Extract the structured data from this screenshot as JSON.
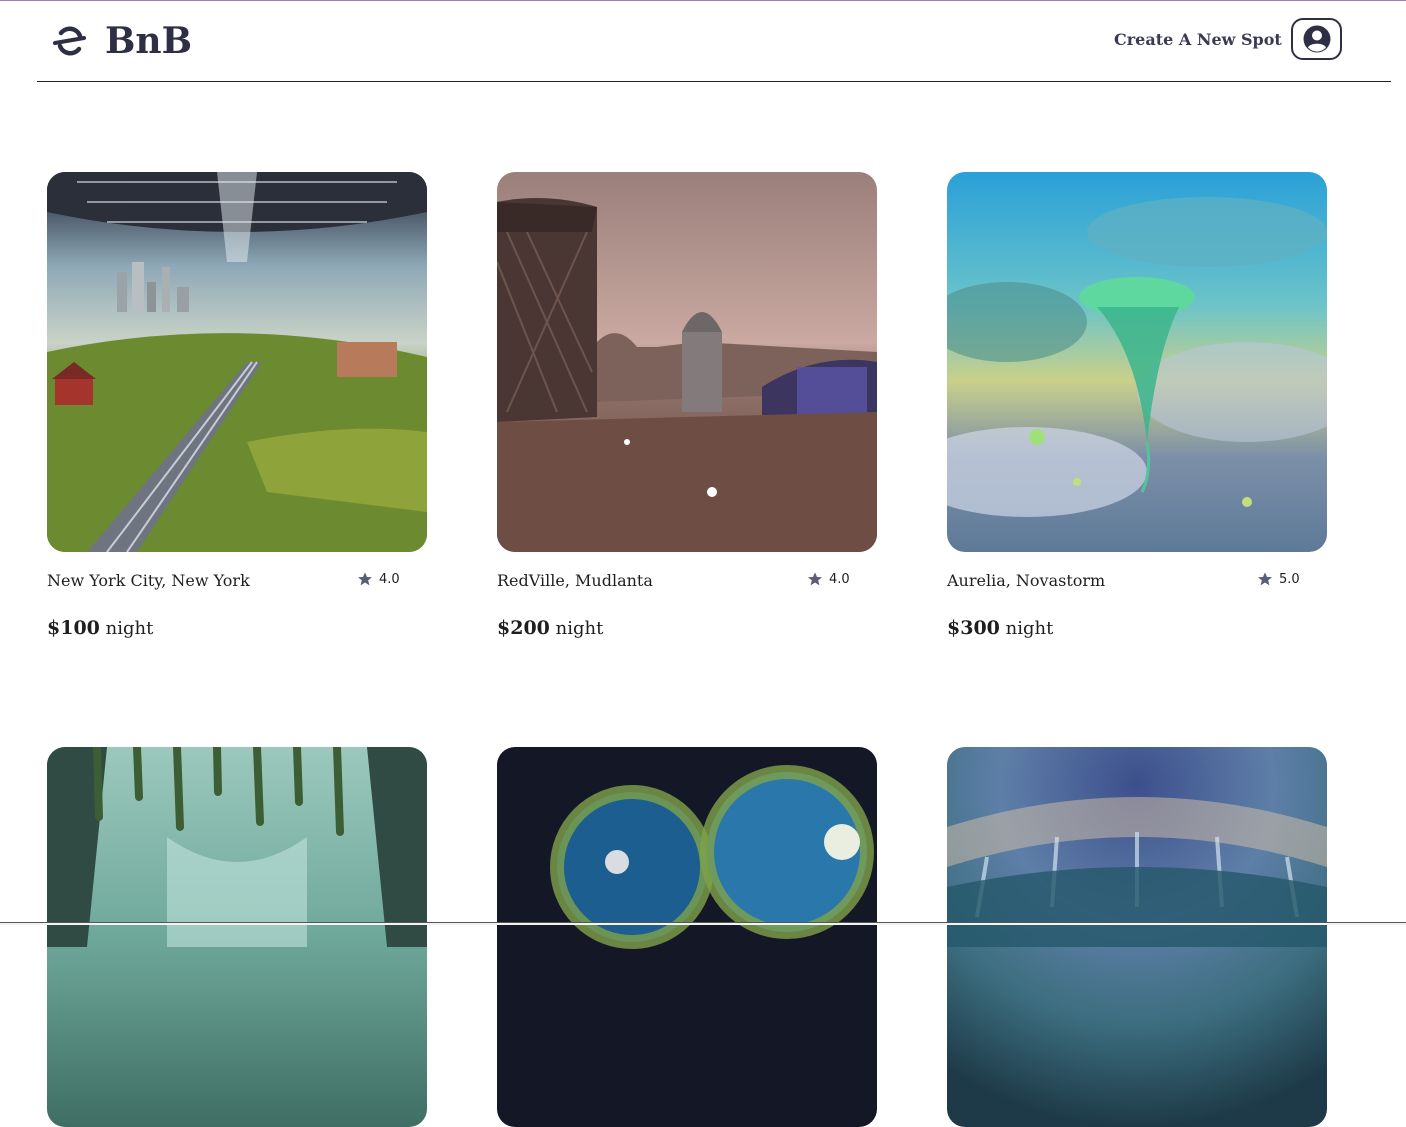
{
  "app": {
    "brand": "BnB",
    "logo_icon": "rotating-arrows-logo-icon"
  },
  "header": {
    "create_spot_label": "Create A New Spot",
    "profile_icon": "user-circle-icon"
  },
  "colors": {
    "brand_text": "#2e2f45",
    "star": "#5a5c78",
    "top_accent": "#9b7fb5"
  },
  "spots": [
    {
      "location": "New York City, New York",
      "rating": "4.0",
      "price": "$100",
      "unit": "night",
      "image": "orbital-farmland-city-scene"
    },
    {
      "location": "RedVille, Mudlanta",
      "rating": "4.0",
      "price": "$200",
      "unit": "night",
      "image": "mars-colony-scene"
    },
    {
      "location": "Aurelia, Novastorm",
      "rating": "5.0",
      "price": "$300",
      "unit": "night",
      "image": "floating-jellyfish-sky-scene"
    },
    {
      "image": "green-canyon-habitat-scene"
    },
    {
      "image": "twin-glass-dome-scene"
    },
    {
      "image": "cracked-dome-city-scene"
    }
  ]
}
